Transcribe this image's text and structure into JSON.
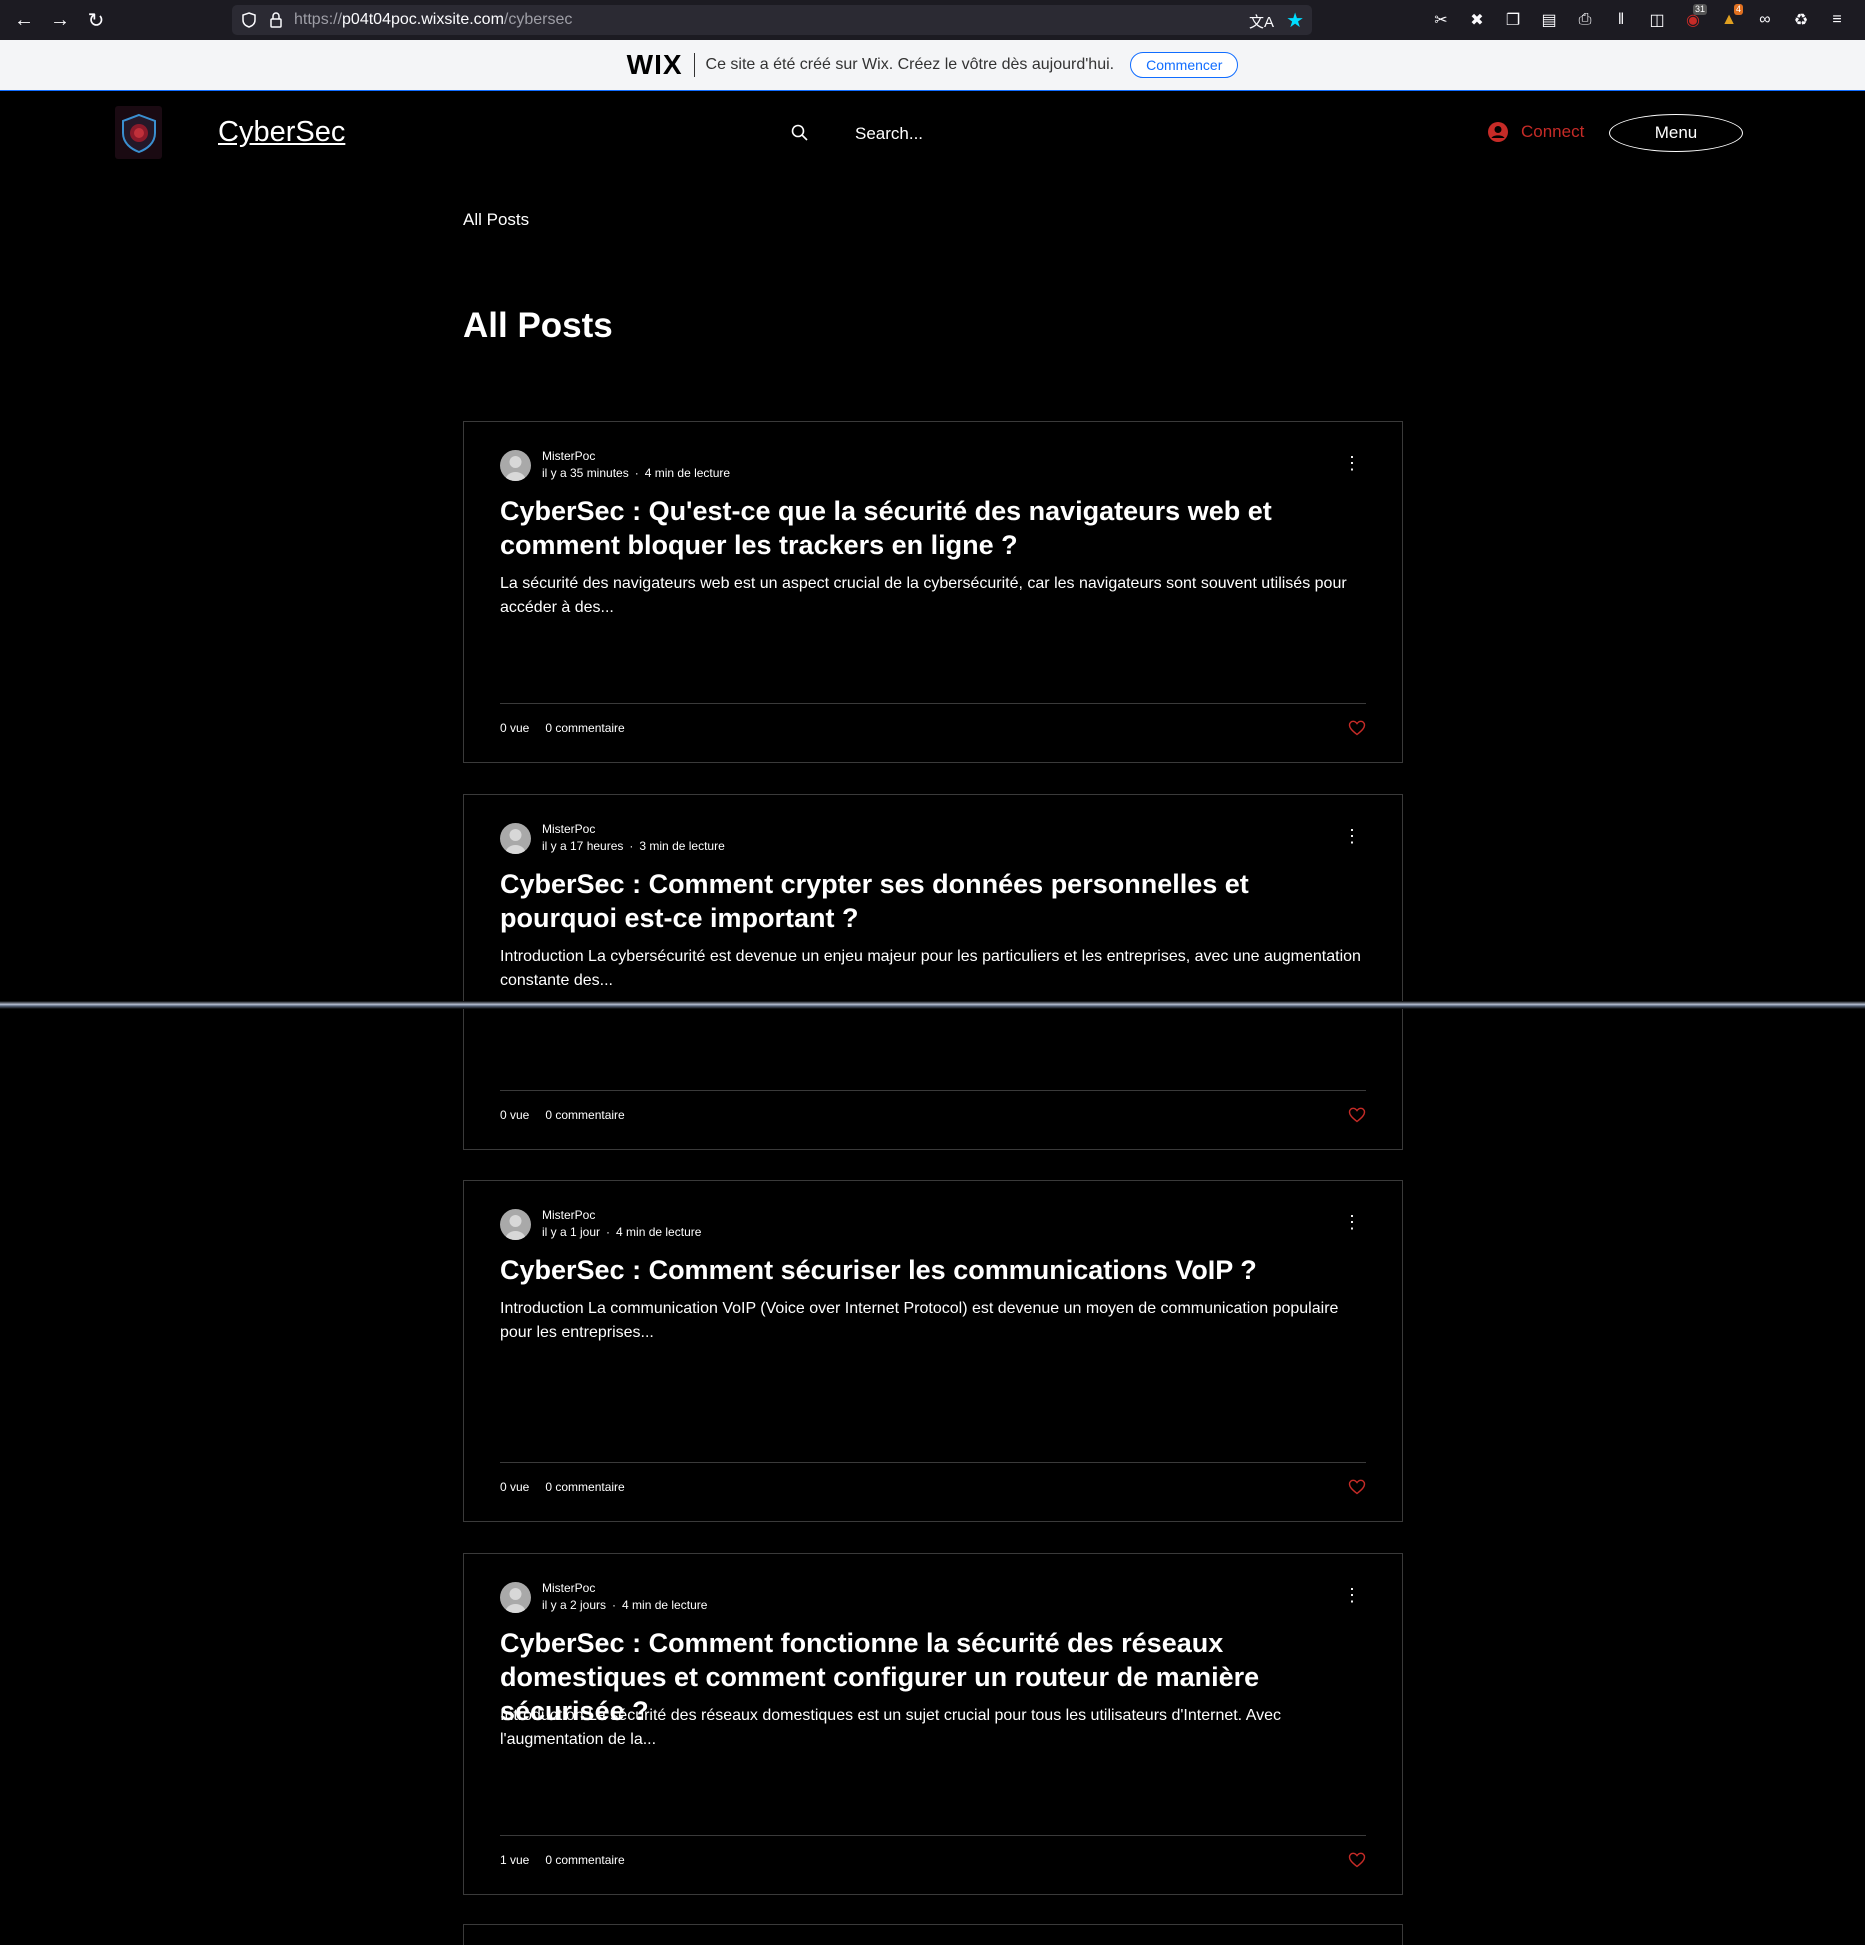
{
  "browser": {
    "url_scheme": "https://",
    "url_host": "p04t04poc.wixsite.com",
    "url_path": "/cybersec",
    "badge_count_1": "31",
    "badge_count_2": "4"
  },
  "wix_banner": {
    "logo": "WIX",
    "text": "Ce site a été créé sur Wix. Créez le vôtre dès aujourd'hui.",
    "button": "Commencer"
  },
  "header": {
    "site_title": "CyberSec",
    "search_placeholder": "Search...",
    "connect_label": "Connect",
    "menu_label": "Menu",
    "accent_color": "#c62b27"
  },
  "breadcrumb": "All Posts",
  "page_title": "All Posts",
  "posts": [
    {
      "author": "MisterPoc",
      "time": "il y a 35 minutes",
      "read_time": "4 min de lecture",
      "title": "CyberSec : Qu'est-ce que la sécurité des navigateurs web et comment bloquer les trackers en ligne ?",
      "excerpt": "La sécurité des navigateurs web est un aspect crucial de la cybersécurité, car les navigateurs sont souvent utilisés pour accéder à des...",
      "views": "0 vue",
      "comments": "0 commentaire"
    },
    {
      "author": "MisterPoc",
      "time": "il y a 17 heures",
      "read_time": "3 min de lecture",
      "title": "CyberSec : Comment crypter ses données personnelles et pourquoi est-ce important ?",
      "excerpt": "Introduction La cybersécurité est devenue un enjeu majeur pour les particuliers et les entreprises, avec une augmentation constante des...",
      "views": "0 vue",
      "comments": "0 commentaire"
    },
    {
      "author": "MisterPoc",
      "time": "il y a 1 jour",
      "read_time": "4 min de lecture",
      "title": "CyberSec : Comment sécuriser les communications VoIP ?",
      "excerpt": "Introduction La communication VoIP (Voice over Internet Protocol) est devenue un moyen de communication populaire pour les entreprises...",
      "views": "0 vue",
      "comments": "0 commentaire"
    },
    {
      "author": "MisterPoc",
      "time": "il y a 2 jours",
      "read_time": "4 min de lecture",
      "title": "CyberSec : Comment fonctionne la sécurité des réseaux domestiques et comment configurer un routeur de manière sécurisée ?",
      "excerpt": "Introduction La sécurité des réseaux domestiques est un sujet crucial pour tous les utilisateurs d'Internet. Avec l'augmentation de la...",
      "views": "1 vue",
      "comments": "0 commentaire"
    }
  ]
}
